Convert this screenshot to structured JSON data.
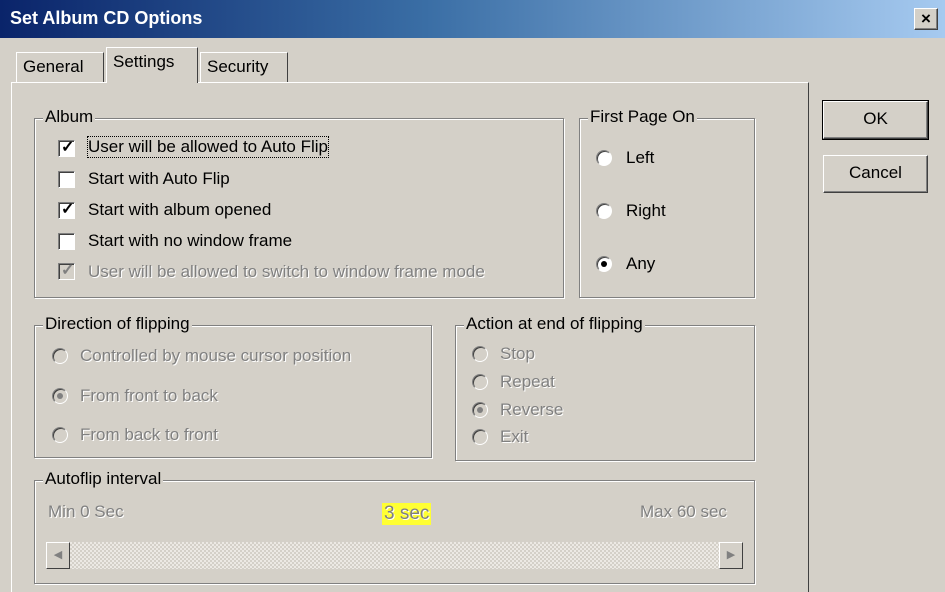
{
  "window": {
    "title": "Set Album CD Options",
    "close_glyph": "×"
  },
  "tabs": [
    {
      "label": "General",
      "active": false
    },
    {
      "label": "Settings",
      "active": true
    },
    {
      "label": "Security",
      "active": false
    }
  ],
  "album": {
    "legend": "Album",
    "items": [
      {
        "label": "User will be allowed to Auto Flip",
        "checked": true,
        "enabled": true
      },
      {
        "label": "Start with Auto Flip",
        "checked": false,
        "enabled": true
      },
      {
        "label": "Start with album opened",
        "checked": true,
        "enabled": true
      },
      {
        "label": "Start with no window frame",
        "checked": false,
        "enabled": true
      },
      {
        "label": "User will be allowed to switch to window frame mode",
        "checked": true,
        "enabled": false
      }
    ]
  },
  "first_page": {
    "legend": "First Page On",
    "options": [
      {
        "label": "Left",
        "selected": false
      },
      {
        "label": "Right",
        "selected": false
      },
      {
        "label": "Any",
        "selected": true
      }
    ]
  },
  "direction": {
    "legend": "Direction of flipping",
    "options": [
      {
        "label": "Controlled by mouse cursor position",
        "selected": false
      },
      {
        "label": "From front to back",
        "selected": true
      },
      {
        "label": "From back to front",
        "selected": false
      }
    ]
  },
  "end_action": {
    "legend": "Action at end of flipping",
    "options": [
      {
        "label": "Stop",
        "selected": false
      },
      {
        "label": "Repeat",
        "selected": false
      },
      {
        "label": "Reverse",
        "selected": true
      },
      {
        "label": "Exit",
        "selected": false
      }
    ]
  },
  "autoflip": {
    "legend": "Autoflip interval",
    "min_label": "Min 0 Sec",
    "value_label": "3 sec",
    "max_label": "Max 60 sec",
    "left_arrow": "◀",
    "right_arrow": "▶",
    "highlight_color": "#ffff33"
  },
  "buttons": {
    "ok": "OK",
    "cancel": "Cancel"
  },
  "colors": {
    "face": "#d4d0c8",
    "title_start": "#0a246a",
    "title_end": "#a6caf0",
    "disabled_text": "#808080"
  }
}
